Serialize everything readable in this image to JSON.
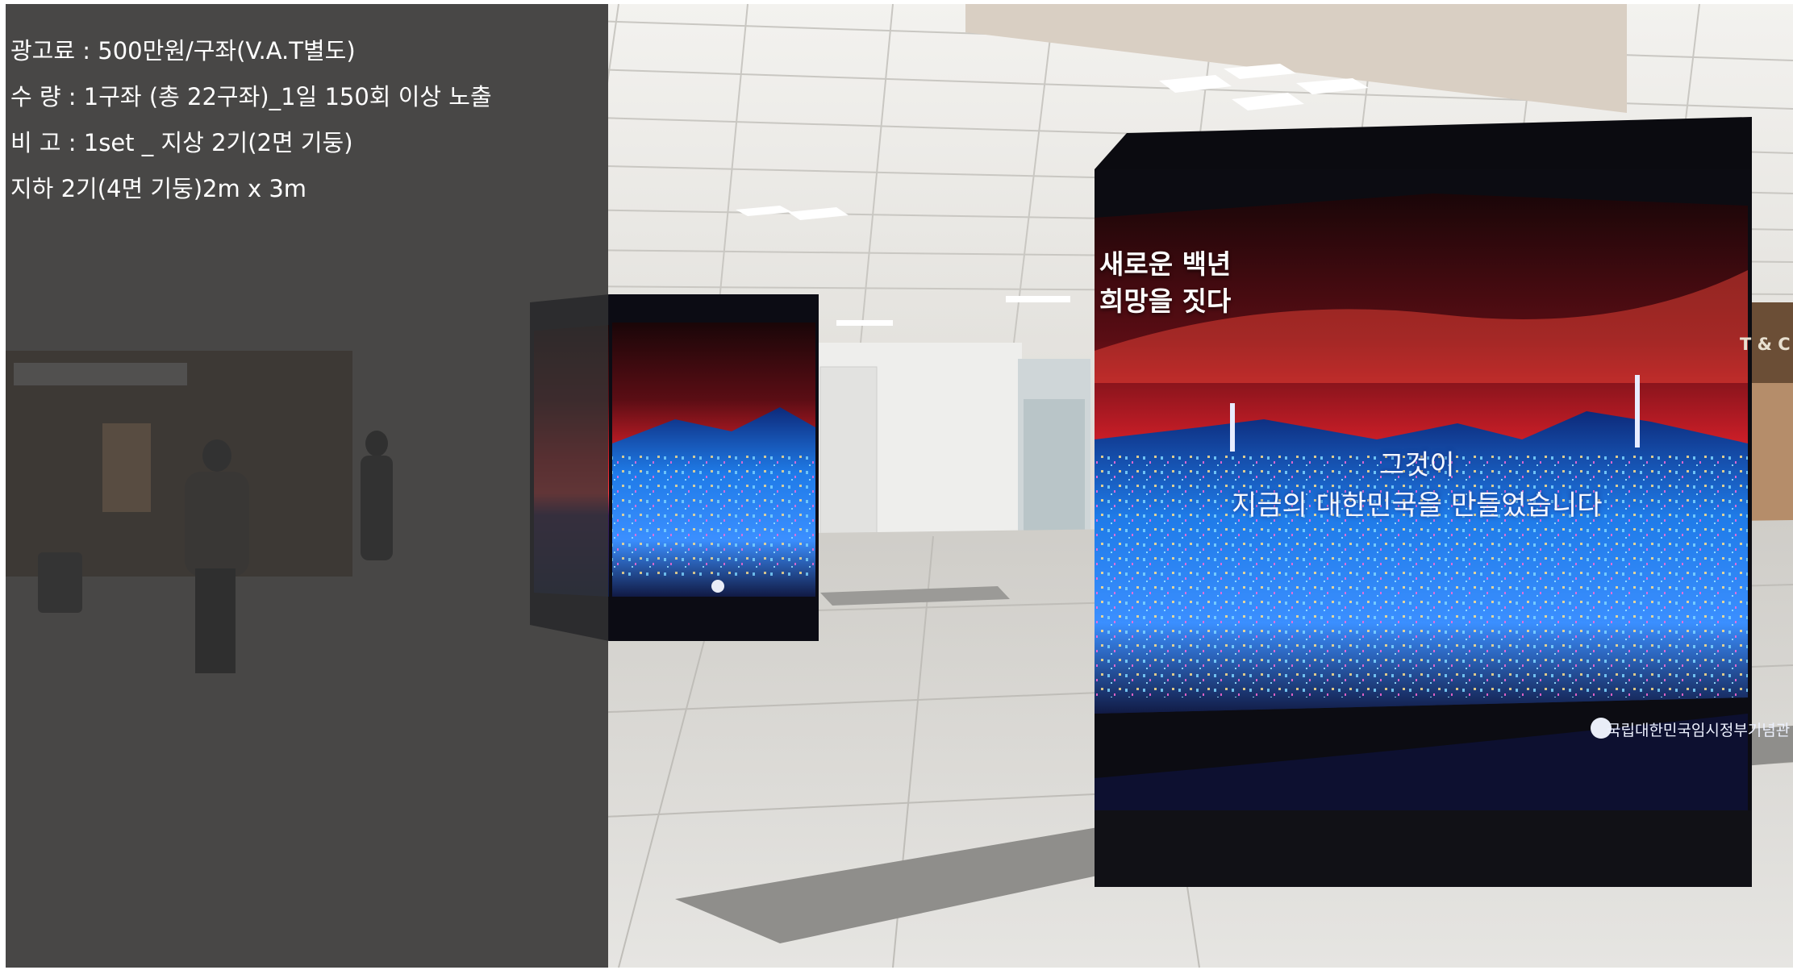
{
  "info_panel": {
    "line1": "광고료 : 500만원/구좌(V.A.T별도)",
    "line2": "수   량 : 1구좌 (총 22구좌)_1일 150회 이상 노출",
    "line3": "비   고 : 1set _ 지상 2기(2면 기둥)",
    "line4": "지하 2기(4면 기둥)2m x 3m"
  },
  "display_content": {
    "headline_line1": "새로운 백년",
    "headline_line2": "희망을 짓다",
    "slogan_line1": "그것이",
    "slogan_line2": "지금의 대한민국을 만들었습니다",
    "ministry": "국립대한민국임시정부기념관",
    "store_sign": "T & C"
  },
  "colors": {
    "panel_overlay": "#343434",
    "floor": "#d4d3cf",
    "ceiling": "#eceae6",
    "sky_red": "#d8202a",
    "city_blue": "#1a6fe0"
  },
  "icons": {
    "ministry_logo": "taegeuk-emblem-icon",
    "exit_sign": "exit-sign-icon"
  }
}
